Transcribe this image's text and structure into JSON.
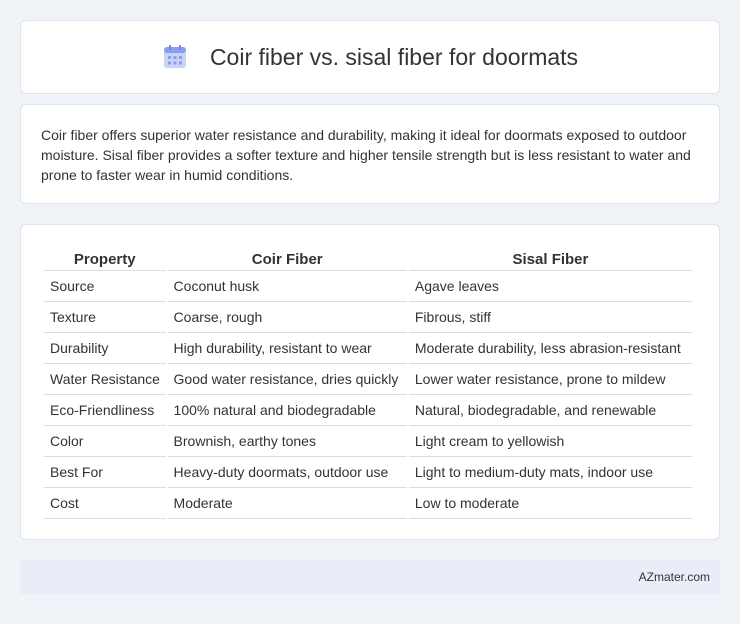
{
  "header": {
    "title": "Coir fiber vs. sisal fiber for doormats",
    "icon": "calendar-grid-icon",
    "icon_color": "#8b9ef0"
  },
  "summary": {
    "text": "Coir fiber offers superior water resistance and durability, making it ideal for doormats exposed to outdoor moisture. Sisal fiber provides a softer texture and higher tensile strength but is less resistant to water and prone to faster wear in humid conditions."
  },
  "table": {
    "headers": [
      "Property",
      "Coir Fiber",
      "Sisal Fiber"
    ],
    "rows": [
      [
        "Source",
        "Coconut husk",
        "Agave leaves"
      ],
      [
        "Texture",
        "Coarse, rough",
        "Fibrous, stiff"
      ],
      [
        "Durability",
        "High durability, resistant to wear",
        "Moderate durability, less abrasion-resistant"
      ],
      [
        "Water Resistance",
        "Good water resistance, dries quickly",
        "Lower water resistance, prone to mildew"
      ],
      [
        "Eco-Friendliness",
        "100% natural and biodegradable",
        "Natural, biodegradable, and renewable"
      ],
      [
        "Color",
        "Brownish, earthy tones",
        "Light cream to yellowish"
      ],
      [
        "Best For",
        "Heavy-duty doormats, outdoor use",
        "Light to medium-duty mats, indoor use"
      ],
      [
        "Cost",
        "Moderate",
        "Low to moderate"
      ]
    ]
  },
  "footer": {
    "site": "AZmater.com"
  }
}
